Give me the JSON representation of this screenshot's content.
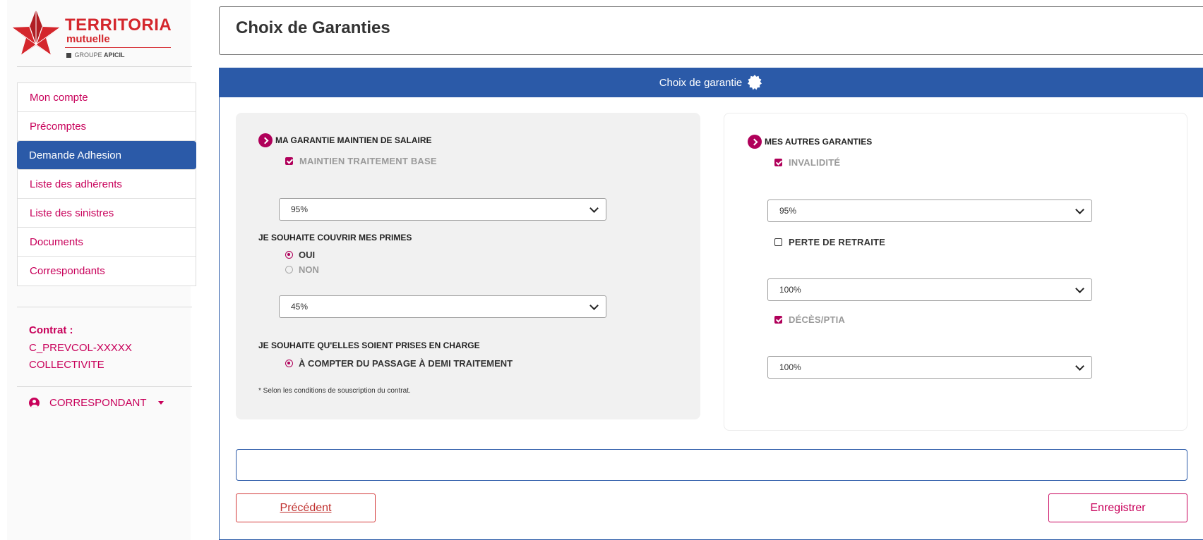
{
  "logo": {
    "brand": "TERRITORIA",
    "sub": "mutuelle",
    "group_prefix": "GROUPE",
    "group_name": "APICIL"
  },
  "sidebar": {
    "items": [
      {
        "label": "Mon compte"
      },
      {
        "label": "Précomptes"
      },
      {
        "label": "Demande Adhesion"
      },
      {
        "label": "Liste des adhérents"
      },
      {
        "label": "Liste des sinistres"
      },
      {
        "label": "Documents"
      },
      {
        "label": "Correspondants"
      }
    ],
    "active_index": 2,
    "contract_label": "Contrat :",
    "contract_code": "C_PREVCOL-XXXXX",
    "contract_type": "COLLECTIVITE",
    "user_role": "CORRESPONDANT"
  },
  "page": {
    "title": "Choix de Garanties"
  },
  "card": {
    "header": "Choix de garantie"
  },
  "left_panel": {
    "section_title": "MA GARANTIE MAINTIEN DE SALAIRE",
    "base_option": "MAINTIEN TRAITEMENT BASE",
    "base_select": "95%",
    "q_primes": "JE SOUHAITE COUVRIR MES PRIMES",
    "radio_yes": "OUI",
    "radio_no": "NON",
    "primes_select": "45%",
    "q_prise": "JE SOUHAITE QU'ELLES SOIENT PRISES EN CHARGE",
    "radio_demi": "À COMPTER DU PASSAGE À DEMI TRAITEMENT",
    "footnote": "* Selon les conditions de souscription du contrat."
  },
  "right_panel": {
    "section_title": "MES AUTRES GARANTIES",
    "invalidite": "INVALIDITÉ",
    "invalidite_select": "95%",
    "perte": "PERTE DE RETRAITE",
    "perte_select": "100%",
    "deces": "DÉCÈS/PTIA",
    "deces_select": "100%"
  },
  "actions": {
    "prev_label": "Précédent",
    "save_label": "Enregistrer"
  },
  "colors": {
    "primary_blue": "#2b5aa8",
    "accent_magenta": "#c8005a",
    "brand_red": "#d4262c"
  }
}
